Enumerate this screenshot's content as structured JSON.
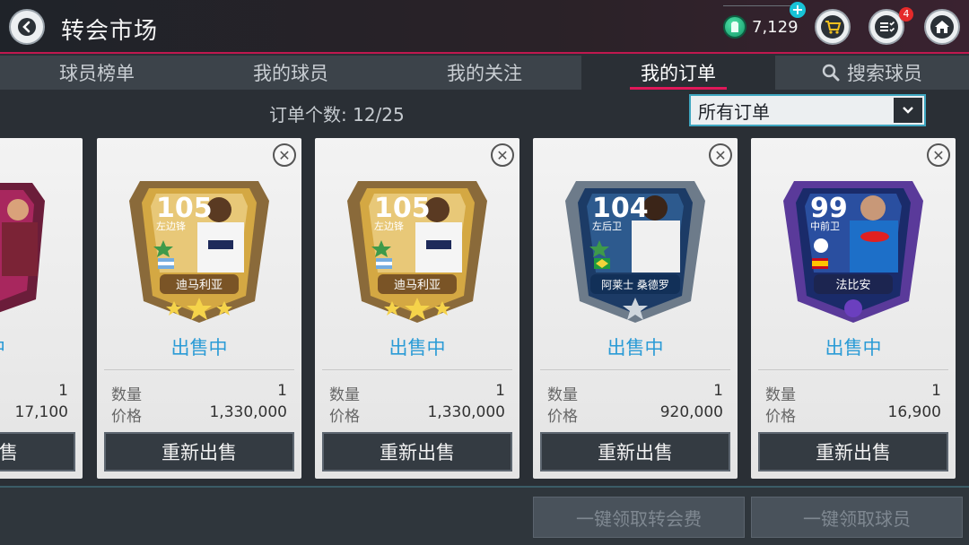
{
  "header": {
    "title": "转会市场",
    "coins": "7,129",
    "notification_count": "4"
  },
  "tabs": [
    {
      "label": "球员榜单"
    },
    {
      "label": "我的球员"
    },
    {
      "label": "我的关注"
    },
    {
      "label": "我的订单"
    },
    {
      "label": "搜索球员"
    }
  ],
  "subbar": {
    "order_count": "订单个数: 12/25",
    "filter_value": "所有订单"
  },
  "labels": {
    "qty": "数量",
    "price": "价格",
    "resell": "重新出售"
  },
  "cards": [
    {
      "rating": "",
      "position": "",
      "name": "",
      "status": "中",
      "qty": "1",
      "price": "17,100",
      "resell": "售",
      "tier": "partial"
    },
    {
      "rating": "105",
      "position": "左边锋",
      "name": "迪马利亚",
      "status": "出售中",
      "qty": "1",
      "price": "1,330,000",
      "tier": "gold"
    },
    {
      "rating": "105",
      "position": "左边锋",
      "name": "迪马利亚",
      "status": "出售中",
      "qty": "1",
      "price": "1,330,000",
      "tier": "gold"
    },
    {
      "rating": "104",
      "position": "左后卫",
      "name": "阿莱士 桑德罗",
      "status": "出售中",
      "qty": "1",
      "price": "920,000",
      "tier": "blue"
    },
    {
      "rating": "99",
      "position": "中前卫",
      "name": "法比安",
      "status": "出售中",
      "qty": "1",
      "price": "16,900",
      "tier": "ucl"
    }
  ],
  "bottom": {
    "claim_fee": "一键领取转会费",
    "claim_players": "一键领取球员"
  },
  "colors": {
    "accent_pink": "#e01859",
    "status_blue": "#2a9bd6",
    "coin_green": "#139869"
  }
}
